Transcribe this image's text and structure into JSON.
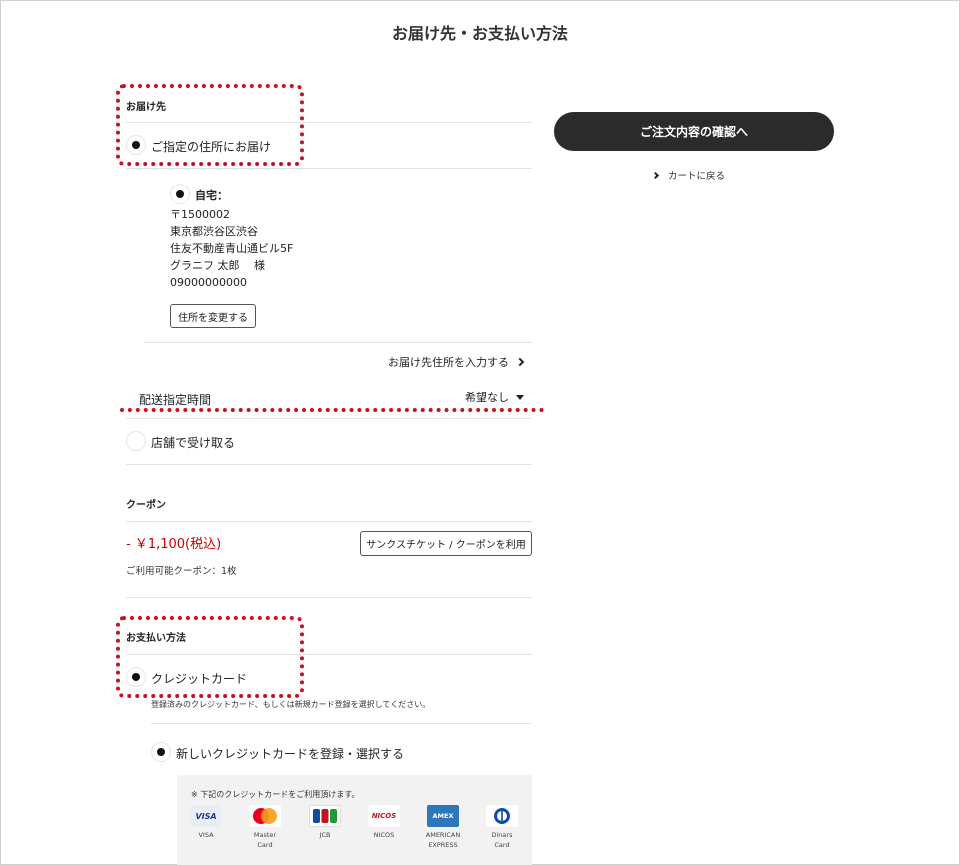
{
  "page": {
    "title": "お届け先・お支払い方法"
  },
  "delivery": {
    "heading": "お届け先",
    "option_designated": "ご指定の住所にお届け",
    "address": {
      "label": "自宅：",
      "postal": "〒1500002",
      "line1": "東京都渋谷区渋谷",
      "line2": "住友不動産青山通ビル5F",
      "name": "グラニフ 太郎　 様",
      "phone": "09000000000"
    },
    "change_address_button": "住所を変更する",
    "enter_address_link": "お届け先住所を入力する",
    "time_label": "配送指定時間",
    "time_value": "希望なし",
    "option_store": "店舗で受け取る"
  },
  "coupon": {
    "heading": "クーポン",
    "discount": "- ￥1,100(税込)",
    "use_button": "サンクスチケット / クーポンを利用",
    "available": "ご利用可能クーポン：1枚"
  },
  "payment": {
    "heading": "お支払い方法",
    "option_credit": "クレジットカード",
    "credit_note": "登録済みのクレジットカード、もしくは新規カード登録を選択してください。",
    "new_card_option": "新しいクレジットカードを登録・選択する",
    "cards_note": "※ 下記のクレジットカードをご利用頂けます。",
    "cards": [
      {
        "name": "VISA",
        "logo_text": "VISA",
        "color": "#e9eef6",
        "text_color": "#1a3a8a"
      },
      {
        "name": "Master\nCard",
        "logo_text": "",
        "color": "#ffffff",
        "text_color": "#ffffff"
      },
      {
        "name": "JCB",
        "logo_text": "JCB",
        "color": "#ffffff",
        "text_color": "#1a3a8a"
      },
      {
        "name": "NICOS",
        "logo_text": "NICOS",
        "color": "#ffffff",
        "text_color": "#c4121f"
      },
      {
        "name": "AMERICAN\nEXPRESS",
        "logo_text": "AMEX",
        "color": "#2e77bb",
        "text_color": "#ffffff"
      },
      {
        "name": "Dinars\nCard",
        "logo_text": "D",
        "color": "#ffffff",
        "text_color": "#1a3a8a"
      }
    ]
  },
  "sidebar": {
    "confirm_button": "ご注文内容の確認へ",
    "back_link": "カートに戻る"
  },
  "colors": {
    "accent_red": "#c4121f",
    "discount_red": "#cc0000",
    "confirm_button_bg": "#2b2b2b"
  }
}
